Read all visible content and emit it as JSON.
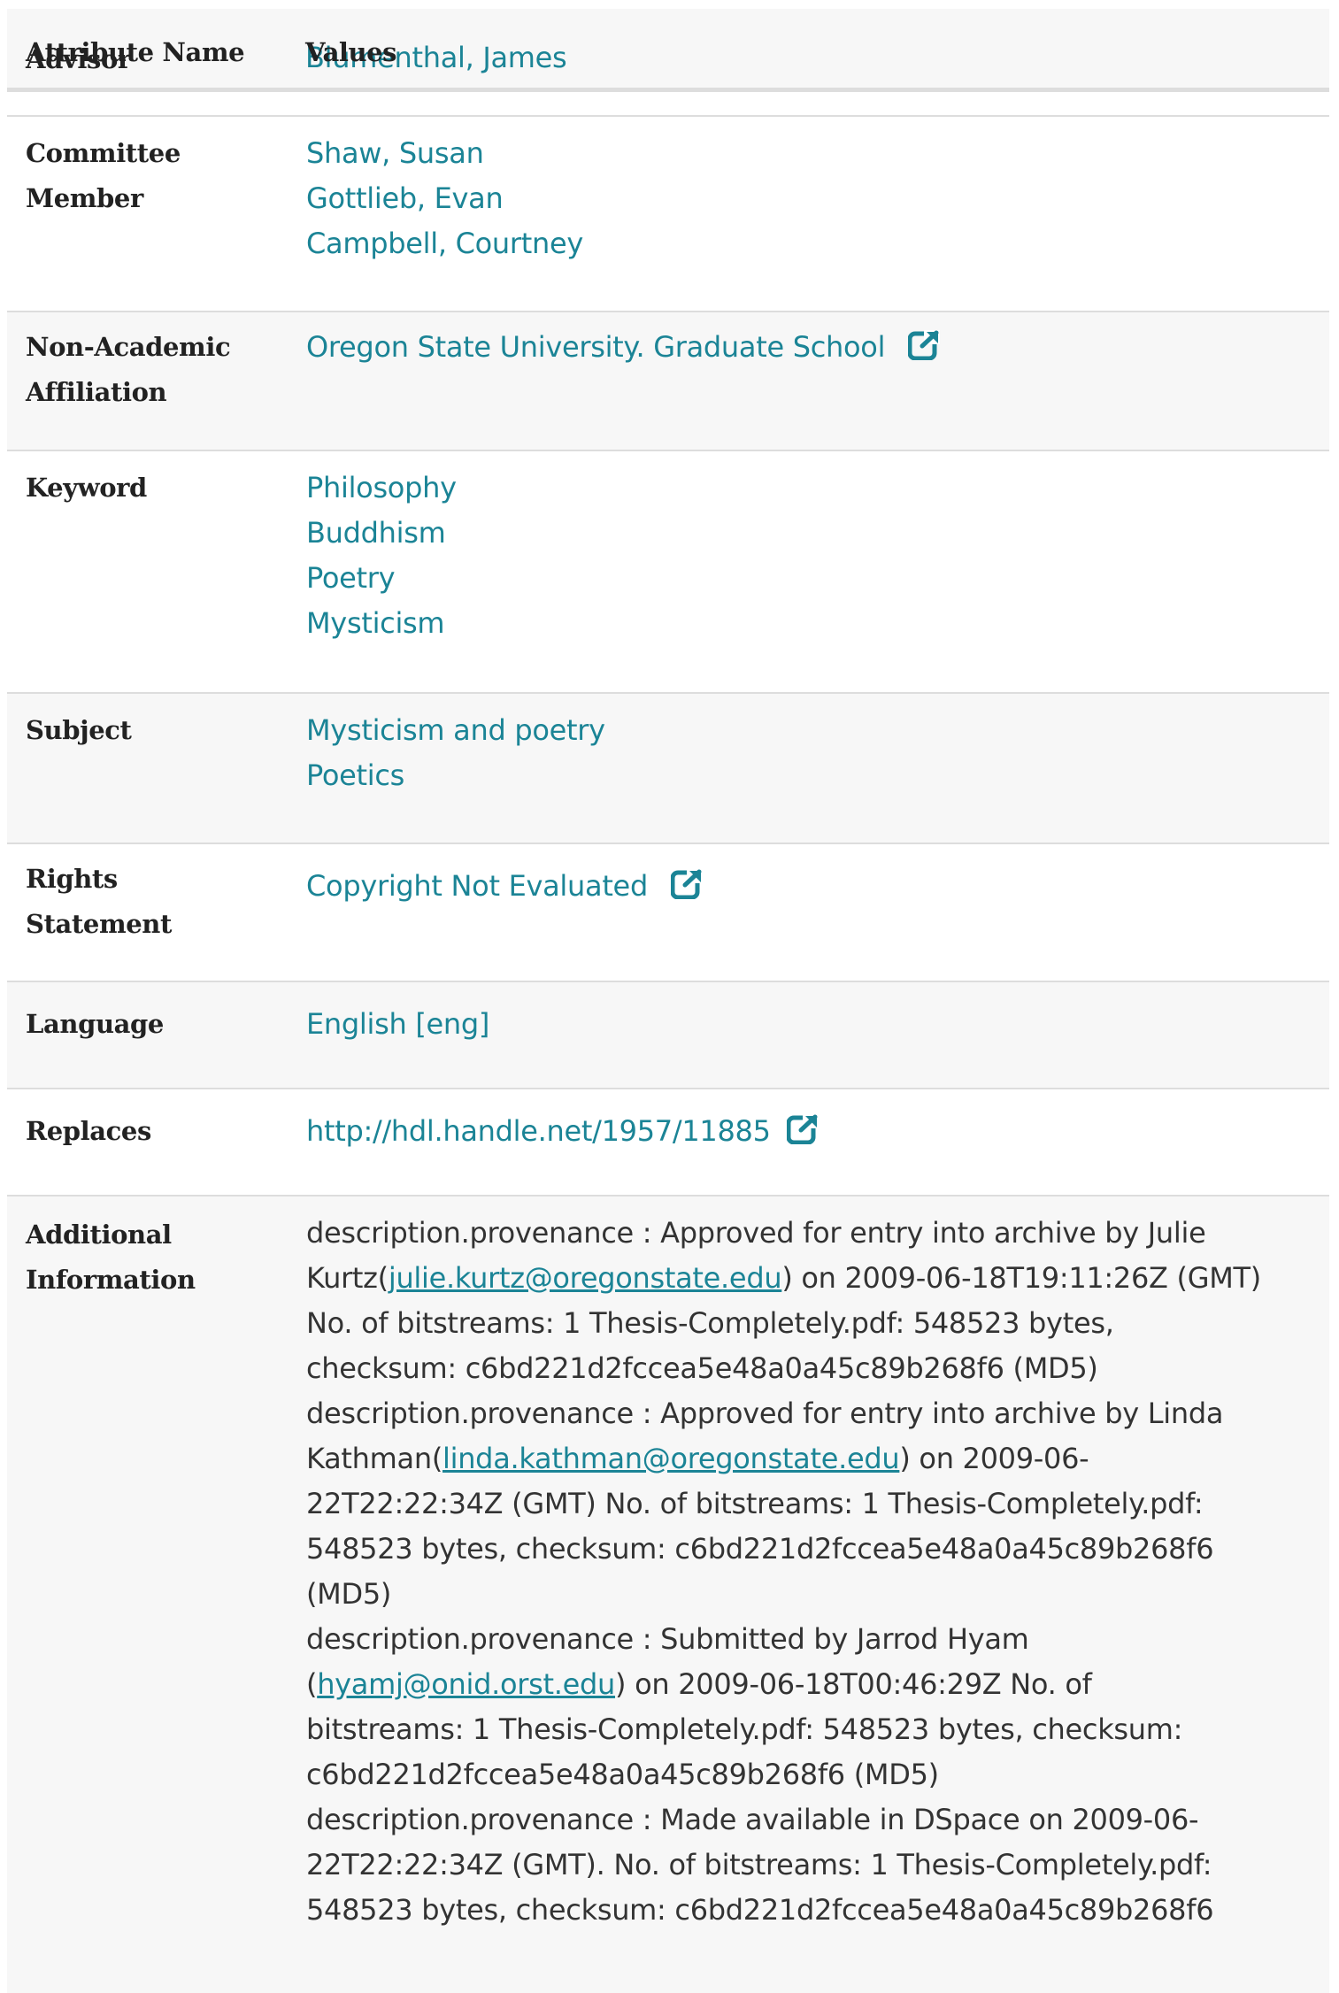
{
  "table": {
    "header": {
      "attribute_name": "Attribute Name",
      "values": "Values"
    },
    "advisor": {
      "label": "Advisor",
      "value": "Blumenthal, James"
    },
    "committee_member": {
      "label_line1": "Committee",
      "label_line2": "Member",
      "values": [
        "Shaw, Susan",
        "Gottlieb, Evan",
        "Campbell, Courtney"
      ]
    },
    "non_academic_affiliation": {
      "label_line1": "Non-Academic",
      "label_line2": "Affiliation",
      "value": "Oregon State University. Graduate School"
    },
    "keyword": {
      "label": "Keyword",
      "values": [
        "Philosophy",
        "Buddhism",
        "Poetry",
        "Mysticism"
      ]
    },
    "subject": {
      "label": "Subject",
      "values": [
        "Mysticism and poetry",
        "Poetics"
      ]
    },
    "rights_statement": {
      "label_line1": "Rights",
      "label_line2": "Statement",
      "value": "Copyright Not Evaluated"
    },
    "language": {
      "label": "Language",
      "value": "English [eng]"
    },
    "replaces": {
      "label": "Replaces",
      "value": "http://hdl.handle.net/1957/11885"
    },
    "additional_information": {
      "label_line1": "Additional",
      "label_line2": "Information",
      "lines": [
        {
          "pre": "description.provenance : Approved for entry into archive by Julie",
          "email": "",
          "post": ""
        },
        {
          "pre": "Kurtz(",
          "email": "julie.kurtz@oregonstate.edu",
          "post": ") on 2009-06-18T19:11:26Z (GMT)"
        },
        {
          "pre": "No. of bitstreams: 1 Thesis-Completely.pdf: 548523 bytes,",
          "email": "",
          "post": ""
        },
        {
          "pre": "checksum: c6bd221d2fccea5e48a0a45c89b268f6 (MD5)",
          "email": "",
          "post": ""
        },
        {
          "pre": "description.provenance : Approved for entry into archive by Linda",
          "email": "",
          "post": ""
        },
        {
          "pre": "Kathman(",
          "email": "linda.kathman@oregonstate.edu",
          "post": ") on 2009-06-"
        },
        {
          "pre": "22T22:22:34Z (GMT) No. of bitstreams: 1 Thesis-Completely.pdf:",
          "email": "",
          "post": ""
        },
        {
          "pre": "548523 bytes, checksum: c6bd221d2fccea5e48a0a45c89b268f6",
          "email": "",
          "post": ""
        },
        {
          "pre": "(MD5)",
          "email": "",
          "post": ""
        },
        {
          "pre": "description.provenance : Submitted by Jarrod Hyam",
          "email": "",
          "post": ""
        },
        {
          "pre": "(",
          "email": "hyamj@onid.orst.edu",
          "post": ") on 2009-06-18T00:46:29Z No. of"
        },
        {
          "pre": "bitstreams: 1 Thesis-Completely.pdf: 548523 bytes, checksum:",
          "email": "",
          "post": ""
        },
        {
          "pre": "c6bd221d2fccea5e48a0a45c89b268f6 (MD5)",
          "email": "",
          "post": ""
        },
        {
          "pre": "description.provenance : Made available in DSpace on 2009-06-",
          "email": "",
          "post": ""
        },
        {
          "pre": "22T22:22:34Z (GMT). No. of bitstreams: 1 Thesis-Completely.pdf:",
          "email": "",
          "post": ""
        },
        {
          "pre": "548523 bytes, checksum: c6bd221d2fccea5e48a0a45c89b268f6",
          "email": "",
          "post": ""
        }
      ]
    }
  },
  "colors": {
    "link": "#1b8496",
    "row_alt": "#f7f7f7",
    "border": "#dddddd",
    "label_text": "#222222",
    "body_text": "#333333"
  },
  "icons": {
    "external_link": "external-link-icon"
  }
}
